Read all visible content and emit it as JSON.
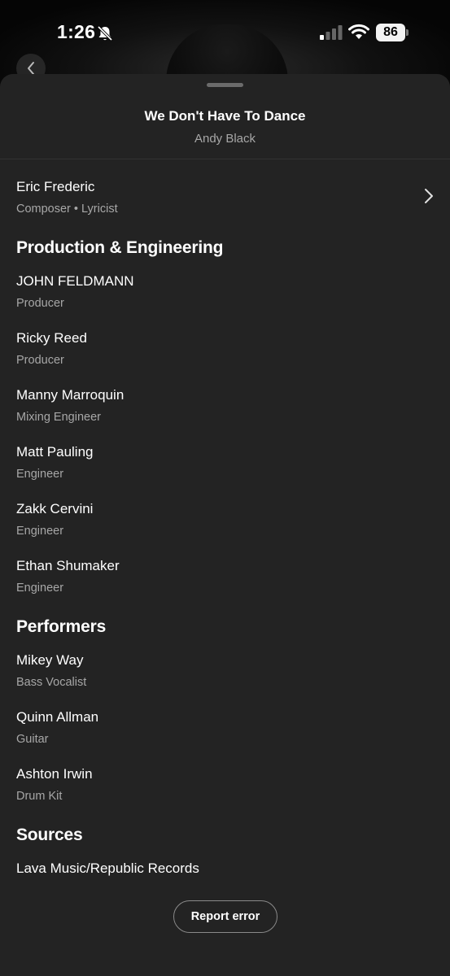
{
  "status_bar": {
    "time": "1:26",
    "battery": "86"
  },
  "header": {
    "title": "We Don't Have To Dance",
    "artist": "Andy Black"
  },
  "top_credit": {
    "name": "Eric Frederic",
    "role": "Composer • Lyricist"
  },
  "sections": {
    "production": {
      "title": "Production & Engineering",
      "items": [
        {
          "name": "JOHN FELDMANN",
          "role": "Producer"
        },
        {
          "name": "Ricky Reed",
          "role": "Producer"
        },
        {
          "name": "Manny Marroquin",
          "role": "Mixing Engineer"
        },
        {
          "name": "Matt Pauling",
          "role": "Engineer"
        },
        {
          "name": "Zakk Cervini",
          "role": "Engineer"
        },
        {
          "name": "Ethan Shumaker",
          "role": "Engineer"
        }
      ]
    },
    "performers": {
      "title": "Performers",
      "items": [
        {
          "name": "Mikey Way",
          "role": "Bass Vocalist"
        },
        {
          "name": "Quinn Allman",
          "role": "Guitar"
        },
        {
          "name": "Ashton Irwin",
          "role": "Drum Kit"
        }
      ]
    },
    "sources": {
      "title": "Sources",
      "items": [
        "Lava Music/Republic Records"
      ]
    }
  },
  "report_button": "Report error",
  "icons": {
    "back": "chevron-left-icon",
    "mute": "bell-slash-icon",
    "signal": "cellular-signal-icon",
    "wifi": "wifi-icon",
    "battery": "battery-icon",
    "chevron": "chevron-right-icon"
  },
  "colors": {
    "sheet": "#232323",
    "secondary_text": "#a7a7a7",
    "background": "#0b0b0b"
  }
}
